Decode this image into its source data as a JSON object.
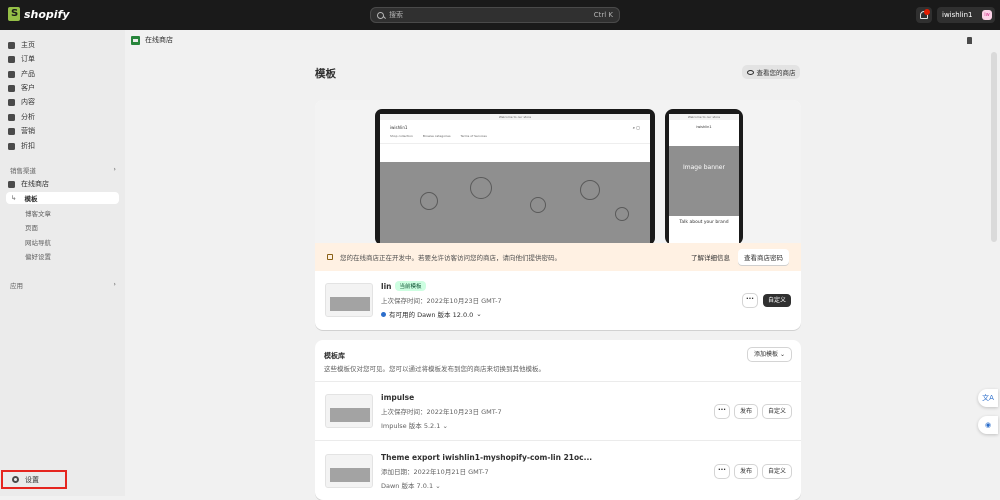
{
  "app": {
    "brand": "shopify",
    "brand_icon": "shopify-bag-icon"
  },
  "search": {
    "placeholder": "搜索",
    "shortcut": "Ctrl K"
  },
  "user": {
    "name": "iwishlin1",
    "initials": "iw"
  },
  "sidebar": {
    "items": [
      {
        "label": "主页",
        "icon": "home-icon"
      },
      {
        "label": "订单",
        "icon": "orders-icon"
      },
      {
        "label": "产品",
        "icon": "tag-icon"
      },
      {
        "label": "客户",
        "icon": "person-icon"
      },
      {
        "label": "内容",
        "icon": "content-icon"
      },
      {
        "label": "分析",
        "icon": "chart-icon"
      },
      {
        "label": "营销",
        "icon": "target-icon"
      },
      {
        "label": "折扣",
        "icon": "discount-icon"
      }
    ],
    "sales_channels_label": "销售渠道",
    "online_store_label": "在线商店",
    "sub_items": [
      "模板",
      "博客文章",
      "页面",
      "网站导航",
      "偏好设置"
    ],
    "apps_label": "应用",
    "settings_label": "设置"
  },
  "breadcrumb": {
    "label": "在线商店"
  },
  "page": {
    "title": "模板",
    "view_store": "查看您的商店"
  },
  "preview": {
    "announcement": "Welcome to our store",
    "store_name": "iwishlin1",
    "nav": [
      "Shop collection",
      "Browse categories",
      "Terms of Services"
    ],
    "phone_banner": "Image banner",
    "phone_text": "Talk about your brand"
  },
  "notice": {
    "text": "您的在线商店正在开发中。若要允许访客访问您的商店，请向他们提供密码。",
    "learn_more": "了解详细信息",
    "password_button": "查看商店密码"
  },
  "current_theme": {
    "name": "lin",
    "badge": "当前模板",
    "saved": "上次保存时间：2022年10月23日 GMT-7",
    "version": "有可用的 Dawn 版本 12.0.0",
    "customize": "自定义"
  },
  "library": {
    "title": "模板库",
    "description": "这些模板仅对您可见。您可以通过将模板发布到您的商店来切换到其他模板。",
    "add_button": "添加模板",
    "themes": [
      {
        "name": "impulse",
        "saved": "上次保存时间：2022年10月23日 GMT-7",
        "version": "Impulse 版本 5.2.1",
        "publish": "发布",
        "customize": "自定义"
      },
      {
        "name": "Theme export iwishlin1-myshopify-com-lin 21oc...",
        "saved": "添加日期：2022年10月21日 GMT-7",
        "version": "Dawn 版本 7.0.1",
        "publish": "发布",
        "customize": "自定义"
      }
    ]
  },
  "fab": {
    "translate": "文A"
  }
}
